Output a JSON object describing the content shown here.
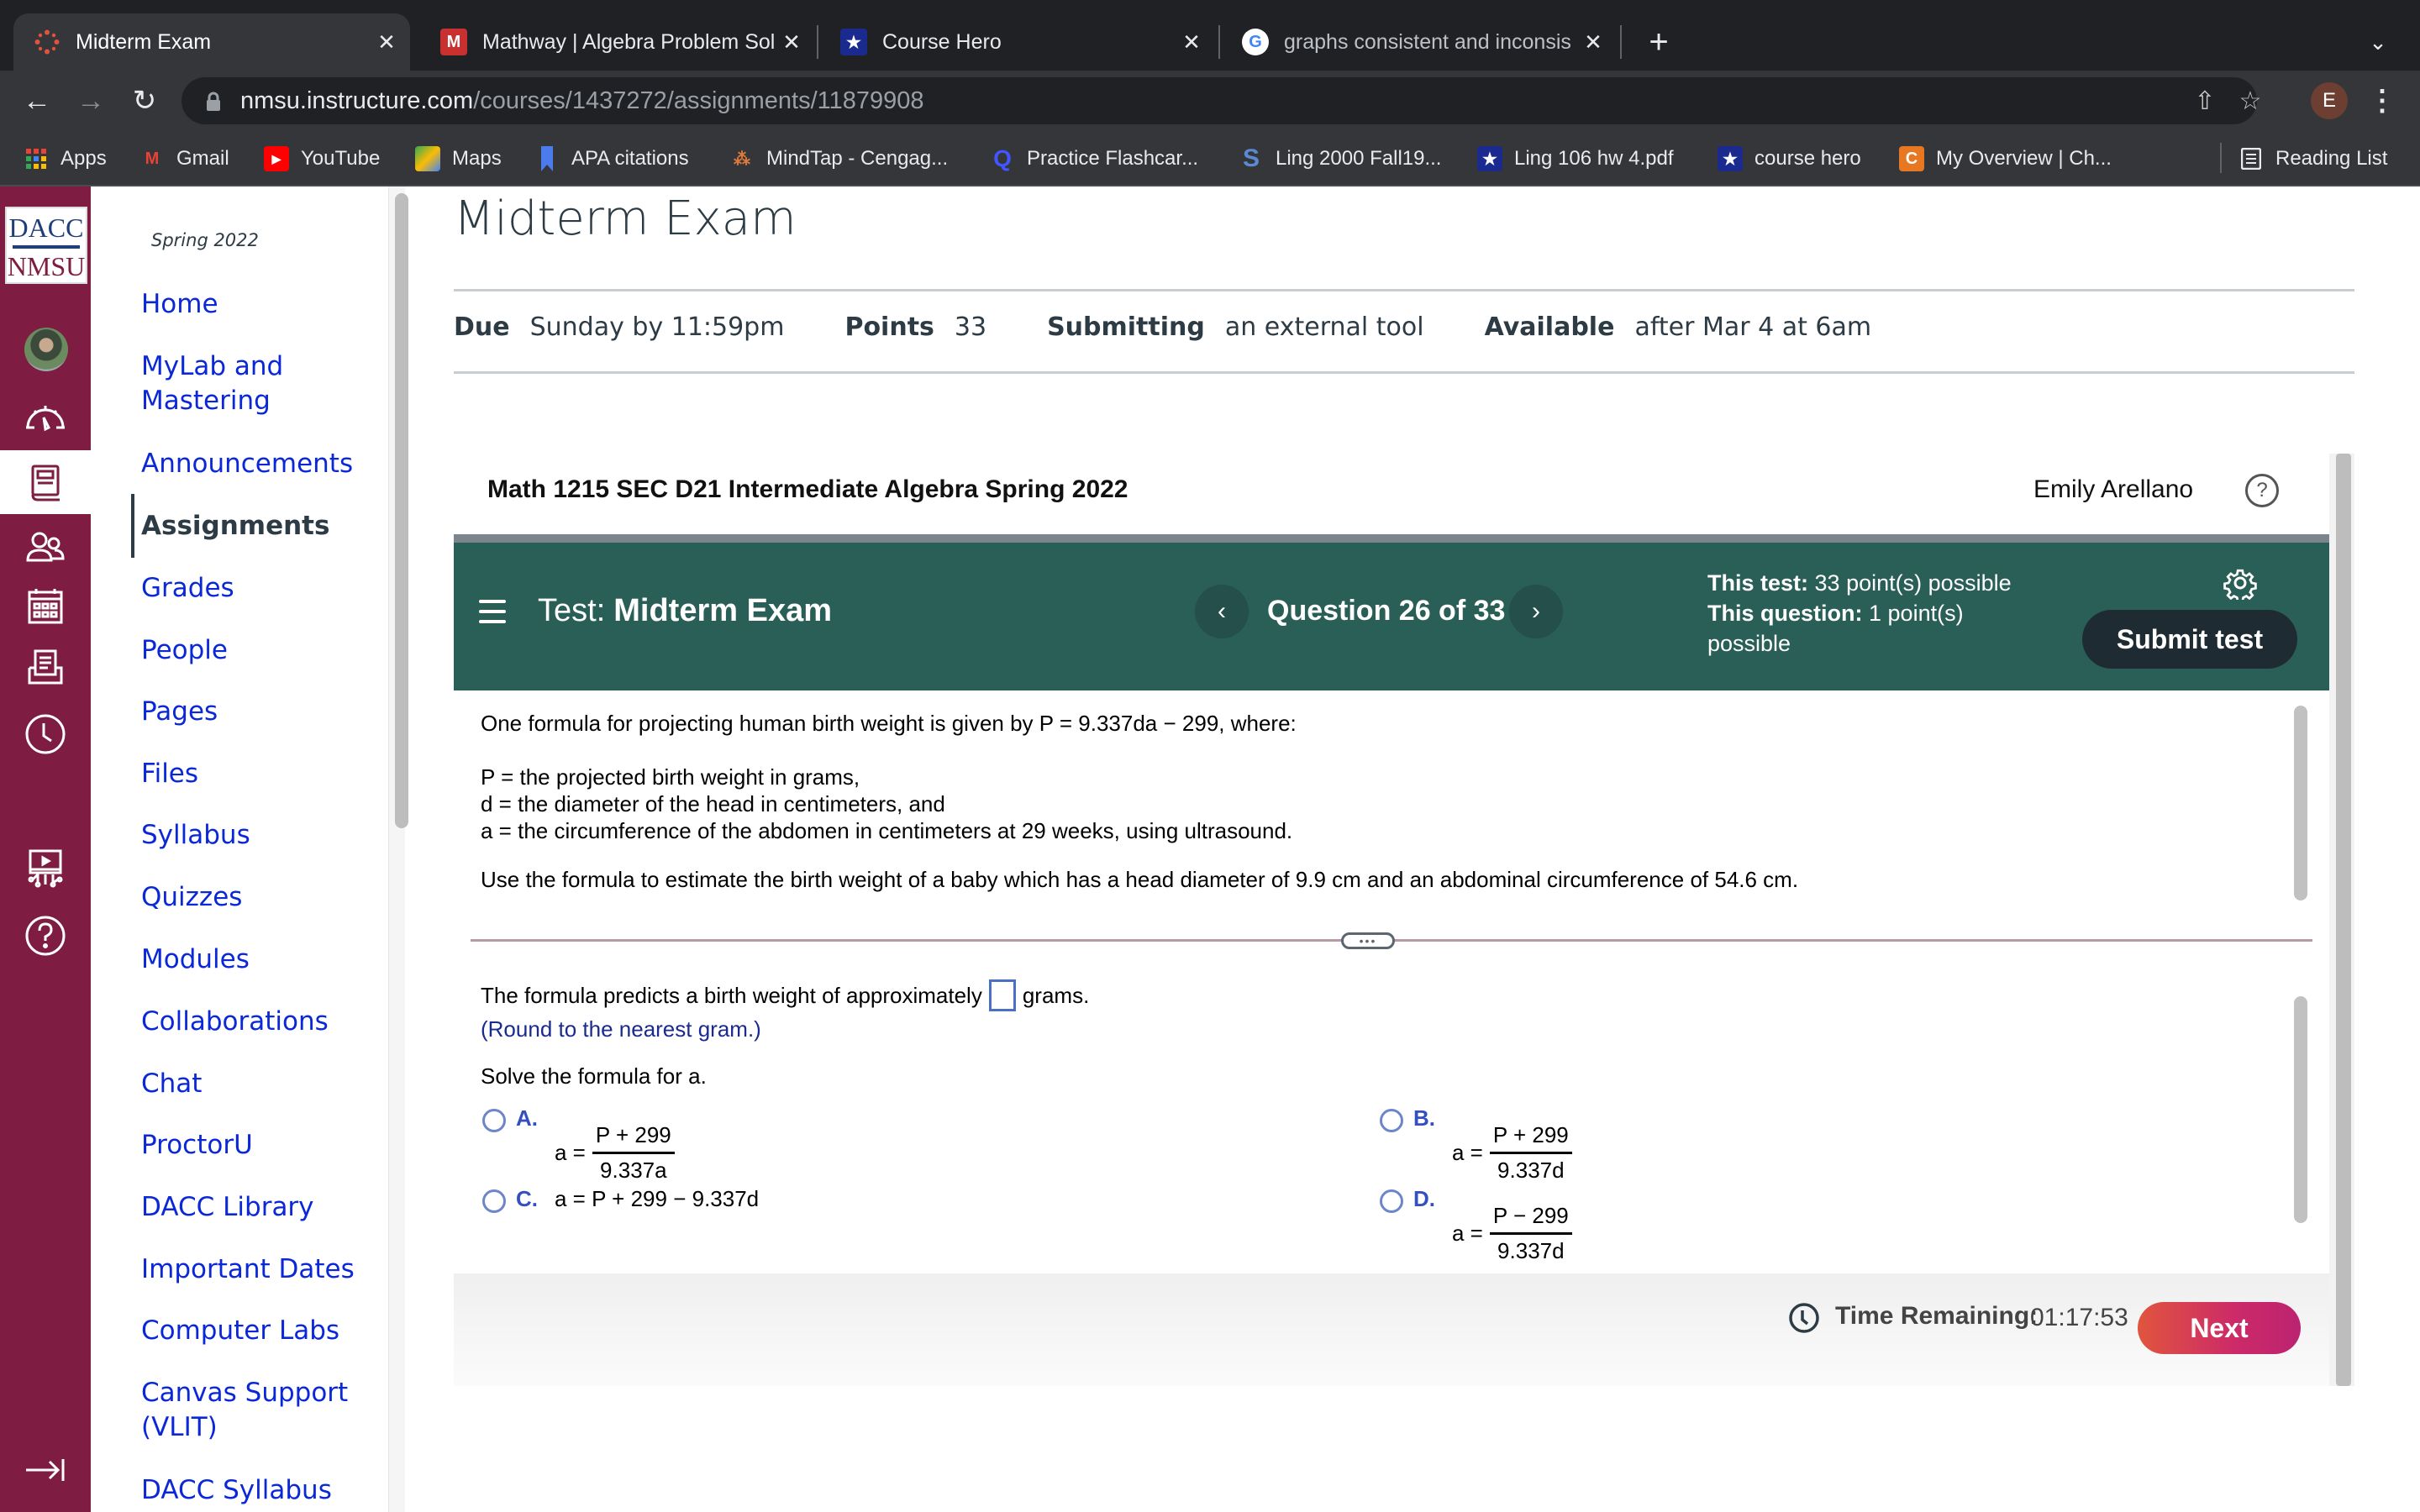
{
  "browser": {
    "tabs": [
      {
        "title": "Midterm Exam",
        "favicon": "canvas-icon",
        "active": true
      },
      {
        "title": "Mathway | Algebra Problem Sol",
        "favicon": "mathway-icon",
        "active": false
      },
      {
        "title": "Course Hero",
        "favicon": "coursehero-icon",
        "active": false
      },
      {
        "title": "graphs consistent and inconsis",
        "favicon": "google-icon",
        "active": false
      }
    ],
    "url_host": "nmsu.instructure.com",
    "url_path": "/courses/1437272/assignments/11879908",
    "profile_initial": "E",
    "bookmarks": [
      {
        "label": "Apps",
        "icon": "apps-grid-icon"
      },
      {
        "label": "Gmail",
        "icon": "gmail-icon"
      },
      {
        "label": "YouTube",
        "icon": "youtube-icon"
      },
      {
        "label": "Maps",
        "icon": "maps-icon"
      },
      {
        "label": "APA citations",
        "icon": "bookmark-icon"
      },
      {
        "label": "MindTap - Cengag...",
        "icon": "mindtap-icon"
      },
      {
        "label": "Practice Flashcar...",
        "icon": "quizlet-icon"
      },
      {
        "label": "Ling 2000 Fall19...",
        "icon": "s-icon"
      },
      {
        "label": "Ling 106 hw 4.pdf",
        "icon": "coursehero-icon"
      },
      {
        "label": "course hero",
        "icon": "coursehero-icon"
      },
      {
        "label": "My Overview | Ch...",
        "icon": "chegg-icon"
      }
    ],
    "reading_list": "Reading List"
  },
  "global_nav": {
    "logo_line1": "DACC",
    "logo_line2": "NMSU",
    "items": [
      "account",
      "dashboard",
      "courses",
      "groups",
      "calendar",
      "inbox",
      "history",
      "studio",
      "help",
      "collapse"
    ]
  },
  "course_nav": {
    "term": "Spring 2022",
    "items": [
      {
        "label": "Home"
      },
      {
        "label": "MyLab and Mastering"
      },
      {
        "label": "Announcements"
      },
      {
        "label": "Assignments",
        "active": true
      },
      {
        "label": "Grades"
      },
      {
        "label": "People"
      },
      {
        "label": "Pages"
      },
      {
        "label": "Files"
      },
      {
        "label": "Syllabus"
      },
      {
        "label": "Quizzes"
      },
      {
        "label": "Modules"
      },
      {
        "label": "Collaborations"
      },
      {
        "label": "Chat"
      },
      {
        "label": "ProctorU"
      },
      {
        "label": "DACC Library"
      },
      {
        "label": "Important Dates"
      },
      {
        "label": "Computer Labs"
      },
      {
        "label": "Canvas Support (VLIT)"
      },
      {
        "label": "DACC Syllabus"
      }
    ]
  },
  "assignment": {
    "title": "Midterm Exam",
    "due_label": "Due",
    "due_value": "Sunday by 11:59pm",
    "points_label": "Points",
    "points_value": "33",
    "submitting_label": "Submitting",
    "submitting_value": "an external tool",
    "available_label": "Available",
    "available_value": "after Mar 4 at 6am"
  },
  "mylab": {
    "course_title": "Math 1215 SEC D21 Intermediate Algebra Spring 2022",
    "student_name": "Emily Arellano",
    "test_prefix": "Test:",
    "test_name": "Midterm Exam",
    "question_position": "Question 26 of 33",
    "this_test_label": "This test:",
    "this_test_value": "33 point(s) possible",
    "this_question_label": "This question:",
    "this_question_value": "1 point(s) possible",
    "submit_label": "Submit test",
    "colors": {
      "header": "#2a5f58",
      "submit": "#1f2b33",
      "next_start": "#e0553e",
      "next_end": "#bb2370"
    }
  },
  "question": {
    "intro": "One formula for projecting human birth weight is given by P = 9.337da − 299, where:",
    "def_p": "P = the projected birth weight in grams,",
    "def_d": "d = the diameter of the head in centimeters, and",
    "def_a": "a = the circumference of the abdomen in centimeters at 29 weeks, using ultrasound.",
    "task": "Use the formula to estimate the birth weight of a baby which has a head diameter of 9.9 cm and an abdominal circumference of 54.6 cm."
  },
  "answer": {
    "prompt_before": "The formula predicts a birth weight of approximately",
    "prompt_after": "grams.",
    "input_value": "",
    "hint": "(Round to the nearest gram.)",
    "solve_prompt": "Solve the formula for a.",
    "choices": [
      {
        "letter": "A.",
        "lhs": "a =",
        "numerator": "P + 299",
        "denominator": "9.337a"
      },
      {
        "letter": "B.",
        "lhs": "a =",
        "numerator": "P + 299",
        "denominator": "9.337d"
      },
      {
        "letter": "C.",
        "expression": "a = P + 299 − 9.337d"
      },
      {
        "letter": "D.",
        "lhs": "a =",
        "numerator": "P − 299",
        "denominator": "9.337d"
      }
    ]
  },
  "footer": {
    "time_label": "Time Remaining:",
    "time_value": "01:17:53",
    "next_label": "Next"
  }
}
